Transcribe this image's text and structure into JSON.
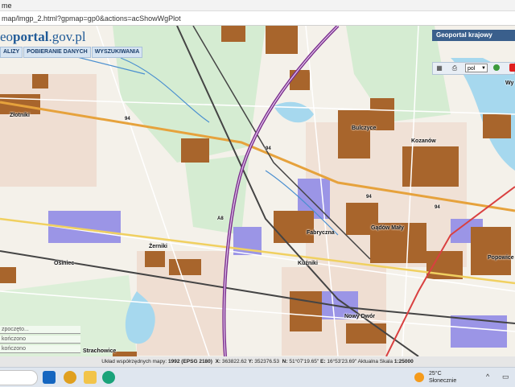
{
  "window": {
    "title": "me"
  },
  "address": {
    "url": "map/lmgp_2.html?gpmap=gp0&actions=acShowWgPlot"
  },
  "header": {
    "logo_prefix": "eo",
    "logo_main": "portal",
    "logo_domain": ".gov.pl",
    "menu": [
      "ALIZY",
      "POBIERANIE DANYCH",
      "WYSZUKIWANIA"
    ]
  },
  "right_panel": {
    "title": "Geoportal krajowy",
    "language": "pol",
    "partial_label": "Wy"
  },
  "search_history": [
    "zpoczęto...",
    "kończono",
    "kończono"
  ],
  "map": {
    "places": [
      {
        "name": "Złotniki"
      },
      {
        "name": "Bulczyce"
      },
      {
        "name": "Kozanów"
      },
      {
        "name": "Fabryczna"
      },
      {
        "name": "Gądów Mały"
      },
      {
        "name": "Popowice"
      },
      {
        "name": "Żerniki"
      },
      {
        "name": "Osiniec"
      },
      {
        "name": "Kuźniki"
      },
      {
        "name": "Nowy Dwór"
      },
      {
        "name": "Strachowice"
      }
    ],
    "road_numbers": [
      "94",
      "94",
      "94",
      "A8",
      "94"
    ],
    "colors": {
      "built_up": "#a8652c",
      "industrial": "#9b95e6",
      "residential": "#ebd2c2",
      "forest": "#d5ecd2",
      "water": "#a6d8ee",
      "motorway": "#7a2e8c"
    }
  },
  "statusbar": {
    "prefix": "Układ współrzędnych mapy:",
    "system": "1992 (EPSG 2180)",
    "x_label": "X:",
    "x": "363822.62",
    "y_label": "Y:",
    "y": "352376.53",
    "n_label": "N:",
    "n": "51°07'19.65\"",
    "e_label": "E:",
    "e": "16°53'23.69\"",
    "scale_label": "Aktualna Skala",
    "scale": "1:25000"
  },
  "taskbar": {
    "weather_temp": "25°C",
    "weather_text": "Słonecznie"
  }
}
